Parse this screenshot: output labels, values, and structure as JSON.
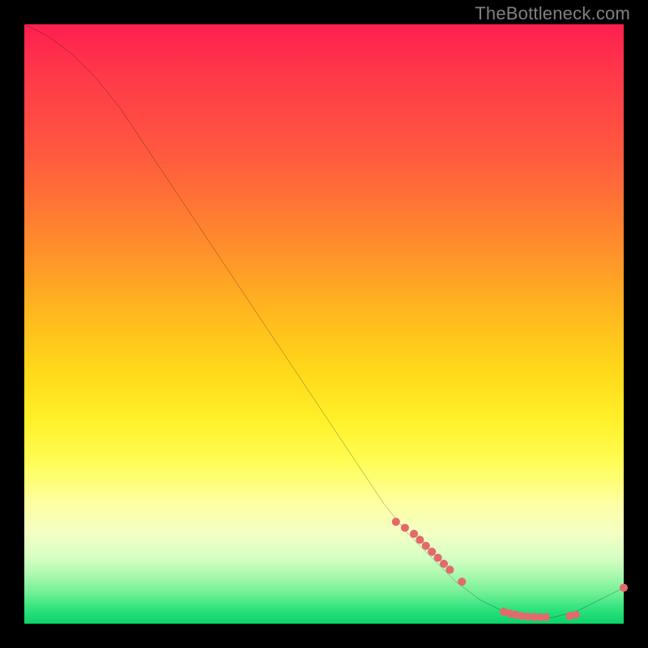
{
  "watermark": "TheBottleneck.com",
  "chart_data": {
    "type": "line",
    "title": "",
    "xlabel": "",
    "ylabel": "",
    "xlim": [
      0,
      100
    ],
    "ylim": [
      0,
      100
    ],
    "curve": {
      "x": [
        0,
        4,
        8,
        12,
        16,
        20,
        24,
        28,
        32,
        36,
        40,
        44,
        48,
        52,
        56,
        60,
        64,
        68,
        72,
        76,
        80,
        84,
        88,
        92,
        96,
        100
      ],
      "y": [
        100,
        98,
        95,
        91,
        86,
        80,
        74,
        68,
        62,
        56,
        50,
        44,
        38,
        32,
        26,
        20,
        15,
        11,
        7,
        4,
        2,
        1,
        1,
        2,
        4,
        6
      ]
    },
    "points": {
      "x": [
        62,
        63.5,
        65,
        66,
        67,
        68,
        69,
        70,
        71,
        73,
        80,
        81,
        82,
        83,
        84,
        85,
        86,
        87,
        91,
        92,
        100
      ],
      "y": [
        17,
        16,
        15,
        14,
        13,
        12,
        11,
        10,
        9,
        7,
        2,
        1.7,
        1.5,
        1.3,
        1.2,
        1.1,
        1.1,
        1.1,
        1.3,
        1.5,
        6
      ]
    },
    "point_style": {
      "color": "#e36a6a",
      "size": 10
    },
    "line_style": {
      "color": "#000000",
      "width": 2
    }
  }
}
